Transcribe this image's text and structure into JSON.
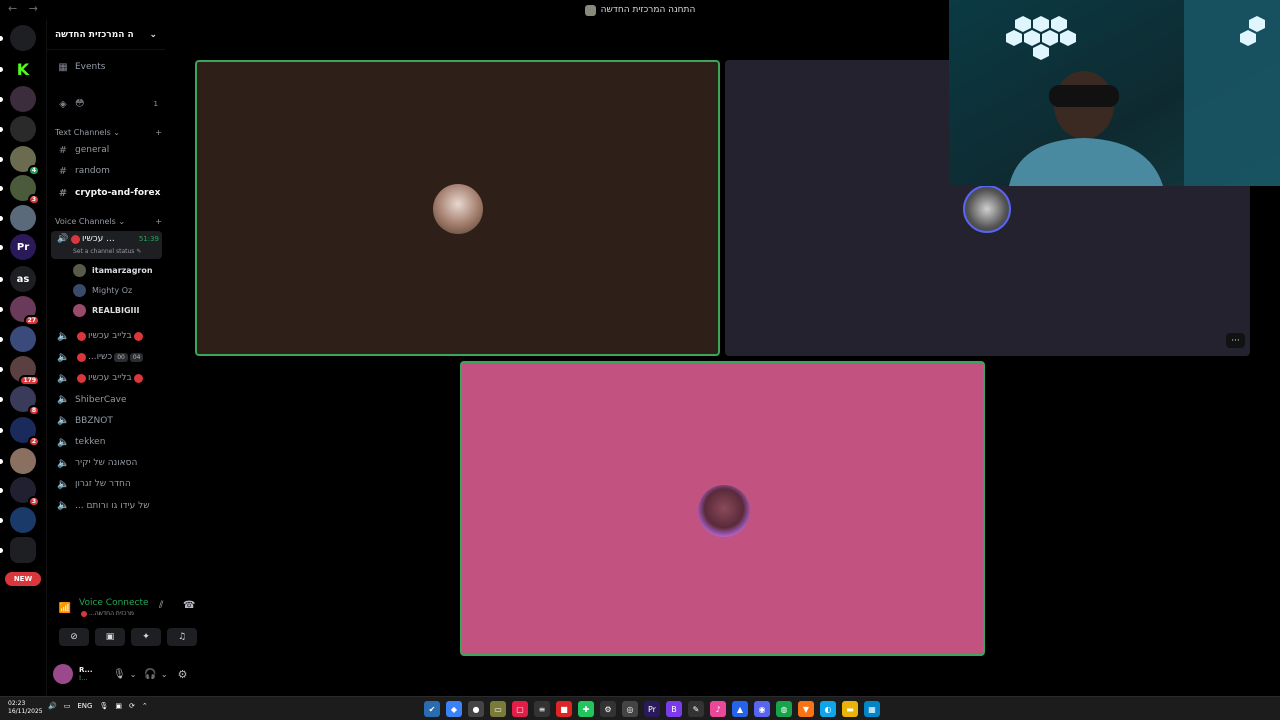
{
  "window": {
    "title": "התחנה המרכזית החדשה",
    "nav_back": "←",
    "nav_forward": "→"
  },
  "server_rail": {
    "items": [
      {
        "name": "home",
        "label": "",
        "color": "#1e1f22",
        "badge": ""
      },
      {
        "name": "kick",
        "label": "K",
        "color": "#000000",
        "badge": ""
      },
      {
        "name": "server-3",
        "label": "",
        "color": "#3b2d3b",
        "badge": ""
      },
      {
        "name": "server-4",
        "label": "",
        "color": "#2a2a2a",
        "badge": ""
      },
      {
        "name": "server-5",
        "label": "",
        "color": "#6b6b50",
        "badge": "4"
      },
      {
        "name": "server-6",
        "label": "",
        "color": "#4a5a3a",
        "badge": "3"
      },
      {
        "name": "server-7",
        "label": "",
        "color": "#5a6a7a",
        "badge": ""
      },
      {
        "name": "premiere",
        "label": "Pr",
        "color": "#2a1a5a",
        "badge": ""
      },
      {
        "name": "server-as",
        "label": "as",
        "color": "#1e1f22",
        "badge": ""
      },
      {
        "name": "server-10",
        "label": "",
        "color": "#6a3a5a",
        "badge": "27"
      },
      {
        "name": "server-11",
        "label": "",
        "color": "#3a4a7a",
        "badge": ""
      },
      {
        "name": "server-12",
        "label": "",
        "color": "#5a4040",
        "badge": "179"
      },
      {
        "name": "server-13",
        "label": "",
        "color": "#3a3a5a",
        "badge": "8"
      },
      {
        "name": "server-14",
        "label": "",
        "color": "#1a2a5a",
        "badge": "2"
      },
      {
        "name": "server-15",
        "label": "",
        "color": "#8a7060",
        "badge": ""
      },
      {
        "name": "server-16",
        "label": "",
        "color": "#202030",
        "badge": "3"
      },
      {
        "name": "server-17",
        "label": "",
        "color": "#1a3a6a",
        "badge": ""
      },
      {
        "name": "folder",
        "label": "",
        "color": "#1e1f22",
        "badge": ""
      }
    ],
    "new_label": "NEW"
  },
  "sidebar": {
    "guild_name": "ה המרכזית החדשה",
    "events_label": "Events",
    "boost_count": "1",
    "text_category": "Text Channels",
    "text_channels": [
      "general",
      "random",
      "crypto-and-forex"
    ],
    "voice_category": "Voice Channels",
    "active_voice": {
      "name": "עכשיו ...",
      "timer": "51:39",
      "status_hint": "Set a channel status"
    },
    "members": [
      {
        "name": "itamarzagron",
        "color": "#5a5a4a"
      },
      {
        "name": "Mighty Oz",
        "color": "#3a4a6a"
      },
      {
        "name": "REALBIGIII",
        "color": "#9a4a6a"
      }
    ],
    "voice_channels": [
      {
        "name": "בלייב עכשיו",
        "dot_before": true,
        "dot_after": true,
        "pills": []
      },
      {
        "name": "...כשיו",
        "dot_before": true,
        "dot_after": false,
        "pills": [
          "00",
          "04"
        ]
      },
      {
        "name": "בלייב עכשיו",
        "dot_before": true,
        "dot_after": true,
        "pills": []
      },
      {
        "name": "ShiberCave",
        "dot_before": false,
        "dot_after": false,
        "pills": []
      },
      {
        "name": "BBZNOT",
        "dot_before": false,
        "dot_after": false,
        "pills": []
      },
      {
        "name": "tekken",
        "dot_before": false,
        "dot_after": false,
        "pills": []
      },
      {
        "name": "הסאונה של יקיר",
        "dot_before": false,
        "dot_after": false,
        "pills": []
      },
      {
        "name": "החדר של זגרון",
        "dot_before": false,
        "dot_after": false,
        "pills": []
      },
      {
        "name": "... של עידו גו ורותם",
        "dot_before": false,
        "dot_after": false,
        "pills": []
      }
    ]
  },
  "voice_panel": {
    "status": "Voice Connecte",
    "channel": "...מרכזית החדשה"
  },
  "user_bar": {
    "name": "R...",
    "sub": "I..."
  },
  "stage": {
    "tiles": [
      {
        "name": "tile-1",
        "bg": "#2e2018",
        "border": "#3ba55c"
      },
      {
        "name": "tile-2",
        "bg": "#24222e",
        "border": "#24222e"
      },
      {
        "name": "tile-3",
        "bg": "#c2527f",
        "border": "#3ba55c"
      }
    ],
    "more_label": "···"
  },
  "taskbar": {
    "time": "02:23",
    "date": "16/11/2025",
    "lang": "ENG",
    "apps": [
      {
        "name": "check",
        "color": "#2b6cb0",
        "glyph": "✔"
      },
      {
        "name": "app-2",
        "color": "#3b82f6",
        "glyph": "◆"
      },
      {
        "name": "app-3",
        "color": "#444444",
        "glyph": "●"
      },
      {
        "name": "app-4",
        "color": "#7a7a3a",
        "glyph": "▭"
      },
      {
        "name": "app-5",
        "color": "#e11d48",
        "glyph": "▢"
      },
      {
        "name": "app-6",
        "color": "#333333",
        "glyph": "≡"
      },
      {
        "name": "app-7",
        "color": "#dc2626",
        "glyph": "■"
      },
      {
        "name": "app-8",
        "color": "#22c55e",
        "glyph": "✚"
      },
      {
        "name": "chatgpt",
        "color": "#333333",
        "glyph": "⚙"
      },
      {
        "name": "app-10",
        "color": "#444444",
        "glyph": "◎"
      },
      {
        "name": "premiere-app",
        "color": "#2a1a5a",
        "glyph": "Pr"
      },
      {
        "name": "app-12",
        "color": "#7c3aed",
        "glyph": "B"
      },
      {
        "name": "app-13",
        "color": "#333333",
        "glyph": "✎"
      },
      {
        "name": "music",
        "color": "#ec4899",
        "glyph": "♪"
      },
      {
        "name": "app-15",
        "color": "#2563eb",
        "glyph": "▲"
      },
      {
        "name": "discord-app",
        "color": "#5865f2",
        "glyph": "◉"
      },
      {
        "name": "chrome",
        "color": "#16a34a",
        "glyph": "◍"
      },
      {
        "name": "brave",
        "color": "#f97316",
        "glyph": "▼"
      },
      {
        "name": "edge",
        "color": "#0ea5e9",
        "glyph": "◐"
      },
      {
        "name": "explorer",
        "color": "#eab308",
        "glyph": "▬"
      },
      {
        "name": "store",
        "color": "#0284c7",
        "glyph": "▦"
      }
    ]
  }
}
